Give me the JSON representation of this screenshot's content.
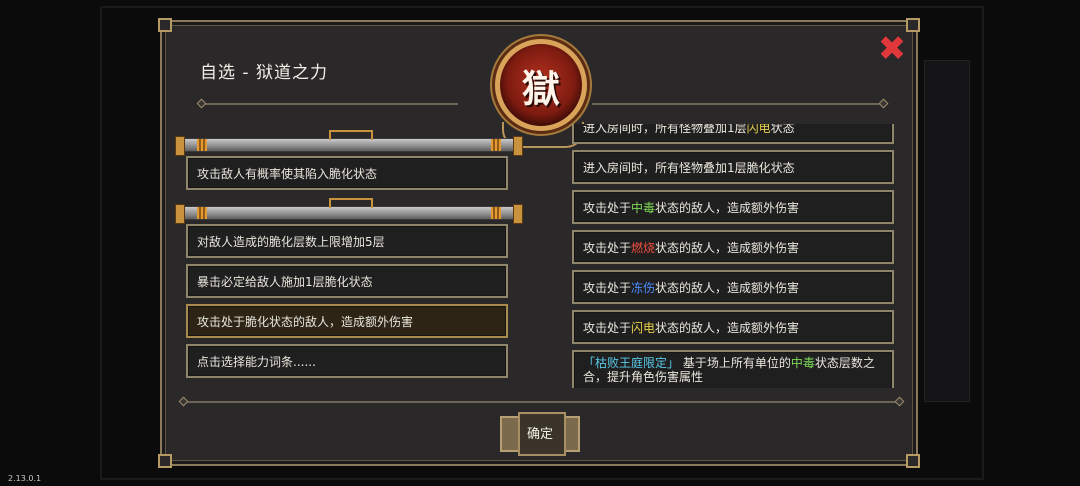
{
  "version": "2.13.0.1",
  "dialog": {
    "title": "自选 - 狱道之力",
    "emblem_glyph": "獄",
    "close_icon": "close-x-icon",
    "accent_color": "#e0383a"
  },
  "left_options": {
    "group1": [
      "攻击敌人有概率使其陷入脆化状态"
    ],
    "group2": [
      "对敌人造成的脆化层数上限增加5层",
      "暴击必定给敌人施加1层脆化状态",
      "攻击处于脆化状态的敌人，造成额外伤害",
      "点击选择能力词条......"
    ]
  },
  "right_options": {
    "partial_top": {
      "pre": "进入房间时，所有怪物叠加1层",
      "keyword": "闪电",
      "post": "状态"
    },
    "rows": [
      {
        "pre": "进入房间时，所有怪物叠加1层脆化状态",
        "keyword": "",
        "post": ""
      },
      {
        "pre": "攻击处于",
        "keyword": "中毒",
        "post": "状态的敌人，造成额外伤害",
        "color": "green"
      },
      {
        "pre": "攻击处于",
        "keyword": "燃烧",
        "post": "状态的敌人，造成额外伤害",
        "color": "red"
      },
      {
        "pre": "攻击处于",
        "keyword": "冻伤",
        "post": "状态的敌人，造成额外伤害",
        "color": "blue"
      },
      {
        "pre": "攻击处于",
        "keyword": "闪电",
        "post": "状态的敌人，造成额外伤害",
        "color": "yellow"
      }
    ],
    "special": {
      "tag": "「枯败王庭限定」",
      "pre": "基于场上所有单位的",
      "keyword": "中毒",
      "post": "状态层数之合，提升角色伤害属性"
    }
  },
  "confirm_label": "确定",
  "colors": {
    "green": "#7ed957",
    "red": "#ee4e3f",
    "blue": "#4a8cff",
    "yellow": "#e6d04a",
    "cyan": "#59c9e8"
  }
}
